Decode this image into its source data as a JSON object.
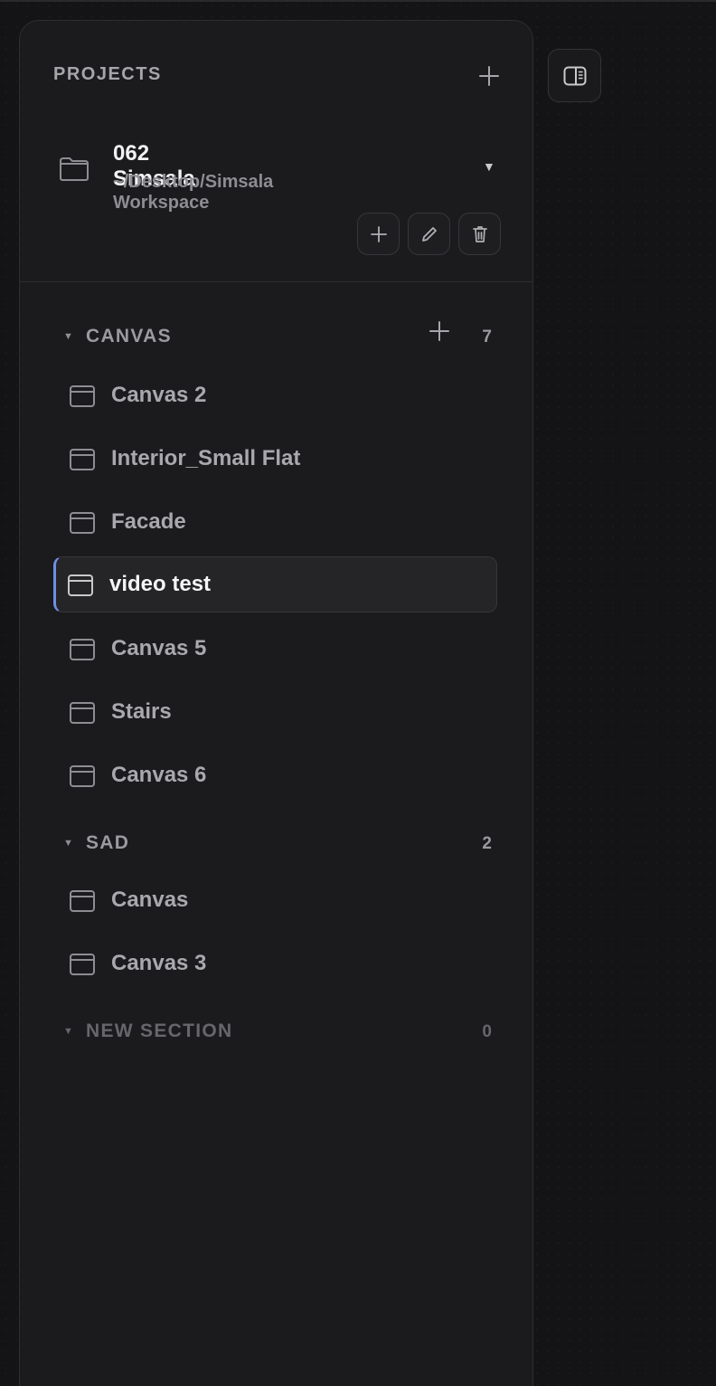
{
  "sidebar": {
    "projects_label": "PROJECTS",
    "project": {
      "name": "062 Simsala",
      "path": "~/Desktop/Simsala Workspace"
    },
    "sections": [
      {
        "title": "CANVAS",
        "count": "7",
        "items": [
          "Canvas 2",
          "Interior_Small Flat",
          "Facade",
          "video test",
          "Canvas 5",
          "Stairs",
          "Canvas 6"
        ],
        "active_index": 3
      },
      {
        "title": "SAD",
        "count": "2",
        "items": [
          "Canvas",
          "Canvas 3"
        ]
      },
      {
        "title": "NEW SECTION",
        "count": "0",
        "items": []
      }
    ]
  },
  "colors": {
    "accent": "#6f8fe8",
    "background": "#141416",
    "panel": "#1b1b1d"
  },
  "icons": {
    "toggle": "sidebar-toggle-icon",
    "project": "folder-icon",
    "item": "canvas-window-icon",
    "add": "plus-icon",
    "edit": "pencil-icon",
    "delete": "trash-icon"
  }
}
